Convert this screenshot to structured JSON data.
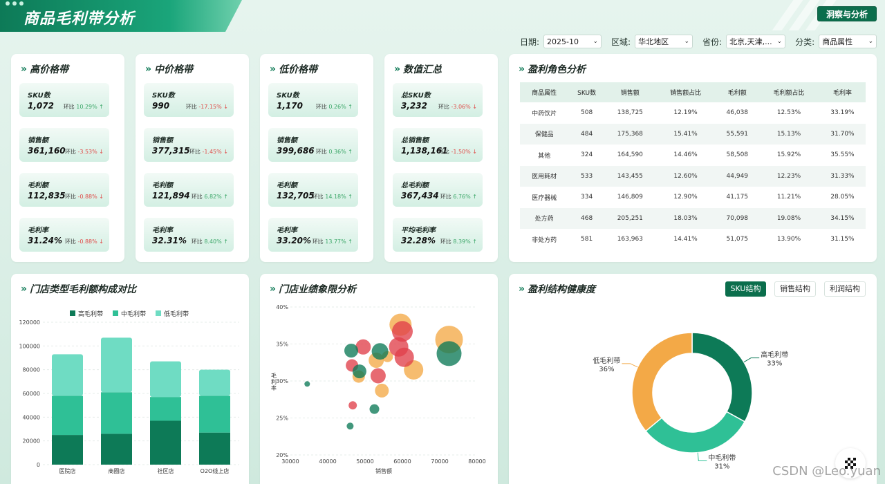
{
  "header": {
    "title": "商品毛利带分析",
    "insight_button": "洞察与分析"
  },
  "filters": [
    {
      "label": "日期:",
      "value": "2025-10"
    },
    {
      "label": "区域:",
      "value": "华北地区"
    },
    {
      "label": "省份:",
      "value": "北京,天津,..."
    },
    {
      "label": "分类:",
      "value": "商品属性"
    }
  ],
  "bands": [
    {
      "title": "高价格带",
      "metrics": [
        {
          "label": "SKU数",
          "value": "1,072",
          "ratio_label": "环比",
          "ratio": "10.29%",
          "trend": "up"
        },
        {
          "label": "销售额",
          "value": "361,160",
          "ratio_label": "环比",
          "ratio": "-3.53%",
          "trend": "down"
        },
        {
          "label": "毛利额",
          "value": "112,835",
          "ratio_label": "环比",
          "ratio": "-0.88%",
          "trend": "down"
        },
        {
          "label": "毛利率",
          "value": "31.24%",
          "ratio_label": "环比",
          "ratio": "-0.88%",
          "trend": "down"
        }
      ]
    },
    {
      "title": "中价格带",
      "metrics": [
        {
          "label": "SKU数",
          "value": "990",
          "ratio_label": "环比",
          "ratio": "-17.15%",
          "trend": "down"
        },
        {
          "label": "销售额",
          "value": "377,315",
          "ratio_label": "环比",
          "ratio": "-1.45%",
          "trend": "down"
        },
        {
          "label": "毛利额",
          "value": "121,894",
          "ratio_label": "环比",
          "ratio": "6.82%",
          "trend": "up"
        },
        {
          "label": "毛利率",
          "value": "32.31%",
          "ratio_label": "环比",
          "ratio": "8.40%",
          "trend": "up"
        }
      ]
    },
    {
      "title": "低价格带",
      "metrics": [
        {
          "label": "SKU数",
          "value": "1,170",
          "ratio_label": "环比",
          "ratio": "0.26%",
          "trend": "up"
        },
        {
          "label": "销售额",
          "value": "399,686",
          "ratio_label": "环比",
          "ratio": "0.36%",
          "trend": "up"
        },
        {
          "label": "毛利额",
          "value": "132,705",
          "ratio_label": "环比",
          "ratio": "14.18%",
          "trend": "up"
        },
        {
          "label": "毛利率",
          "value": "33.20%",
          "ratio_label": "环比",
          "ratio": "13.77%",
          "trend": "up"
        }
      ]
    },
    {
      "title": "数值汇总",
      "metrics": [
        {
          "label": "总SKU数",
          "value": "3,232",
          "ratio_label": "环比",
          "ratio": "-3.06%",
          "trend": "down"
        },
        {
          "label": "总销售额",
          "value": "1,138,161",
          "ratio_label": "环比",
          "ratio": "-1.50%",
          "trend": "down"
        },
        {
          "label": "总毛利额",
          "value": "367,434",
          "ratio_label": "环比",
          "ratio": "6.76%",
          "trend": "up"
        },
        {
          "label": "平均毛利率",
          "value": "32.28%",
          "ratio_label": "环比",
          "ratio": "8.39%",
          "trend": "up"
        }
      ]
    }
  ],
  "role_table": {
    "title": "盈利角色分析",
    "columns": [
      "商品属性",
      "SKU数",
      "销售额",
      "销售额占比",
      "毛利额",
      "毛利额占比",
      "毛利率"
    ],
    "rows": [
      [
        "中药饮片",
        "508",
        "138,725",
        "12.19%",
        "46,038",
        "12.53%",
        "33.19%"
      ],
      [
        "保健品",
        "484",
        "175,368",
        "15.41%",
        "55,591",
        "15.13%",
        "31.70%"
      ],
      [
        "其他",
        "324",
        "164,590",
        "14.46%",
        "58,508",
        "15.92%",
        "35.55%"
      ],
      [
        "医用耗材",
        "533",
        "143,455",
        "12.60%",
        "44,949",
        "12.23%",
        "31.33%"
      ],
      [
        "医疗器械",
        "334",
        "146,809",
        "12.90%",
        "41,175",
        "11.21%",
        "28.05%"
      ],
      [
        "处方药",
        "468",
        "205,251",
        "18.03%",
        "70,098",
        "19.08%",
        "34.15%"
      ],
      [
        "非处方药",
        "581",
        "163,963",
        "14.41%",
        "51,075",
        "13.90%",
        "31.15%"
      ]
    ]
  },
  "bar_card": {
    "title": "门店类型毛利额构成对比"
  },
  "scatter_card": {
    "title": "门店业绩象限分析"
  },
  "donut_card": {
    "title": "盈利结构健康度",
    "tabs": [
      "SKU结构",
      "销售结构",
      "利润结构"
    ],
    "active_tab": 0
  },
  "watermark": "CSDN @Leo.yuan",
  "colors": {
    "high": "#0d7a57",
    "mid": "#2fc096",
    "low": "#6fdcc3",
    "orange": "#f3a947",
    "red": "#e0404a",
    "accent": "#0b6e4c"
  },
  "chart_data": [
    {
      "type": "bar",
      "stacked": true,
      "categories": [
        "医院店",
        "商圈店",
        "社区店",
        "O2O线上店"
      ],
      "series": [
        {
          "name": "高毛利带",
          "values": [
            25000,
            26000,
            37000,
            27000
          ]
        },
        {
          "name": "中毛利带",
          "values": [
            33000,
            35000,
            20000,
            31000
          ]
        },
        {
          "name": "低毛利带",
          "values": [
            35000,
            46000,
            30000,
            22000
          ]
        }
      ],
      "ylim": [
        0,
        120000
      ],
      "yticks": [
        0,
        20000,
        40000,
        60000,
        80000,
        100000,
        120000
      ],
      "legend": "top-center",
      "grid": true
    },
    {
      "type": "scatter",
      "xlabel": "销售额",
      "ylabel": "毛利率",
      "xlim": [
        30000,
        80000
      ],
      "ylim": [
        0.2,
        0.4
      ],
      "xticks": [
        "30000",
        "40000",
        "50000",
        "60000",
        "70000",
        "80000"
      ],
      "yticks": [
        "20%",
        "25%",
        "30%",
        "35%",
        "40%"
      ],
      "points": [
        {
          "x": 34500,
          "y": 0.296,
          "size": 4,
          "group": "green"
        },
        {
          "x": 46000,
          "y": 0.239,
          "size": 5,
          "group": "green"
        },
        {
          "x": 46300,
          "y": 0.341,
          "size": 10,
          "group": "green"
        },
        {
          "x": 48500,
          "y": 0.313,
          "size": 10,
          "group": "green"
        },
        {
          "x": 52500,
          "y": 0.262,
          "size": 7,
          "group": "green"
        },
        {
          "x": 54000,
          "y": 0.34,
          "size": 12,
          "group": "green"
        },
        {
          "x": 72500,
          "y": 0.337,
          "size": 18,
          "group": "green"
        },
        {
          "x": 46700,
          "y": 0.267,
          "size": 6,
          "group": "red"
        },
        {
          "x": 46500,
          "y": 0.321,
          "size": 9,
          "group": "red"
        },
        {
          "x": 49500,
          "y": 0.346,
          "size": 11,
          "group": "red"
        },
        {
          "x": 53500,
          "y": 0.307,
          "size": 11,
          "group": "red"
        },
        {
          "x": 59000,
          "y": 0.346,
          "size": 14,
          "group": "red"
        },
        {
          "x": 60000,
          "y": 0.367,
          "size": 15,
          "group": "red"
        },
        {
          "x": 60500,
          "y": 0.332,
          "size": 14,
          "group": "red"
        },
        {
          "x": 48300,
          "y": 0.306,
          "size": 9,
          "group": "orange"
        },
        {
          "x": 53000,
          "y": 0.328,
          "size": 11,
          "group": "orange"
        },
        {
          "x": 54500,
          "y": 0.287,
          "size": 10,
          "group": "orange"
        },
        {
          "x": 56000,
          "y": 0.333,
          "size": 8,
          "group": "orange"
        },
        {
          "x": 59500,
          "y": 0.376,
          "size": 16,
          "group": "orange"
        },
        {
          "x": 63000,
          "y": 0.315,
          "size": 14,
          "group": "orange"
        },
        {
          "x": 72500,
          "y": 0.356,
          "size": 20,
          "group": "orange"
        }
      ],
      "grid": true
    },
    {
      "type": "pie",
      "donut": true,
      "slices": [
        {
          "name": "高毛利带",
          "value": 33,
          "label": "33%"
        },
        {
          "name": "中毛利带",
          "value": 31,
          "label": "31%"
        },
        {
          "name": "低毛利带",
          "value": 36,
          "label": "36%"
        }
      ]
    }
  ]
}
